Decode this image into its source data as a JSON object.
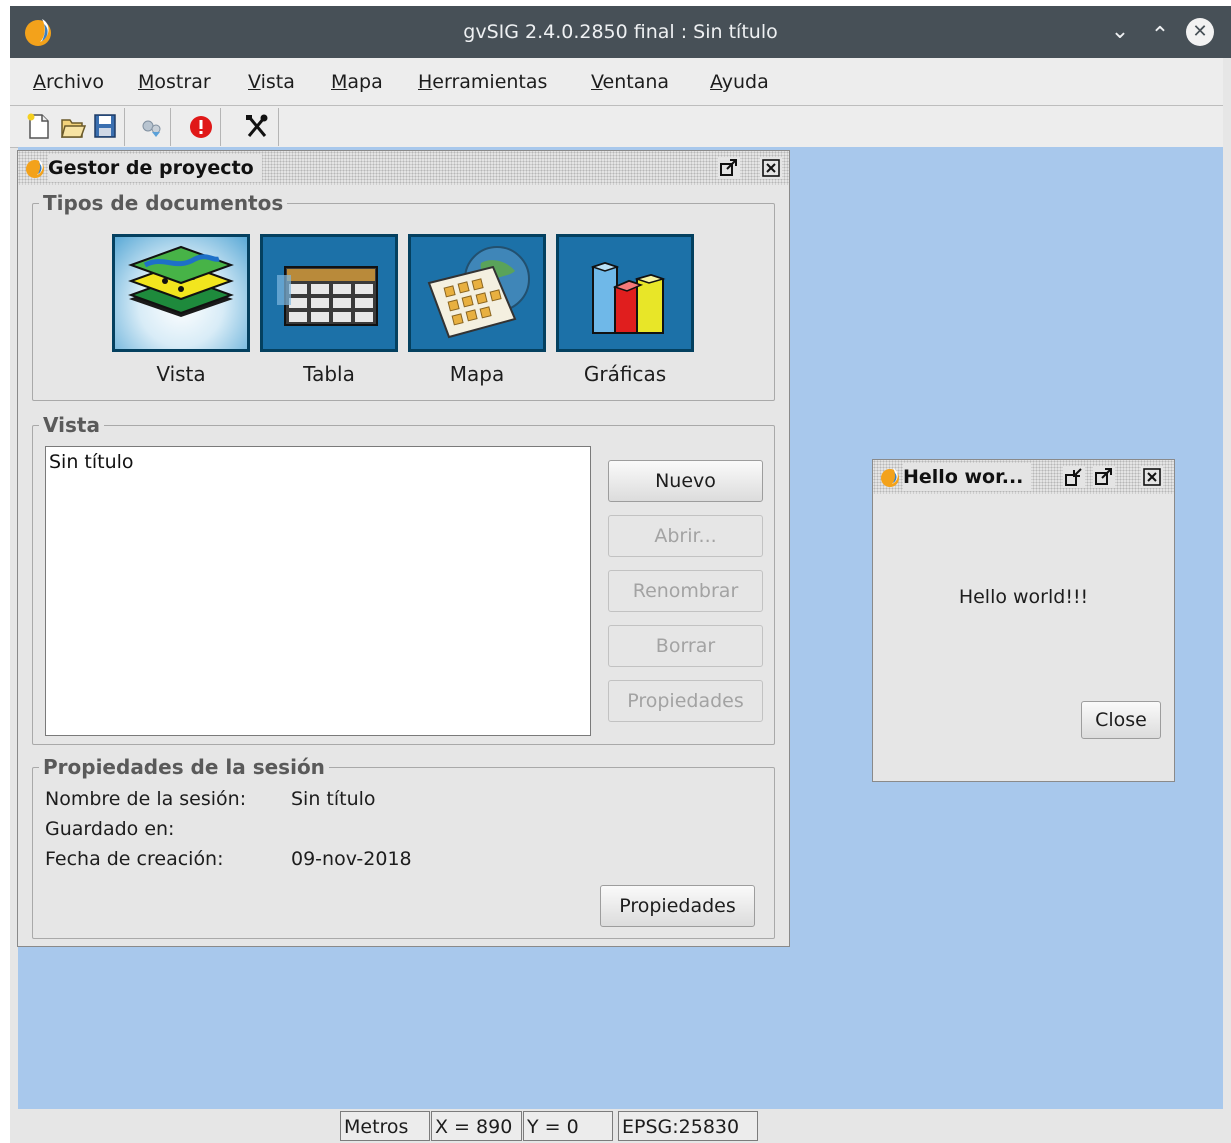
{
  "window": {
    "title": "gvSIG 2.4.0.2850 final : Sin título",
    "controls": [
      "chevron-down-icon",
      "chevron-up-icon",
      "close-icon"
    ]
  },
  "menu": {
    "items": [
      {
        "mnemonic": "A",
        "rest": "rchivo"
      },
      {
        "mnemonic": "M",
        "rest": "ostrar"
      },
      {
        "mnemonic": "V",
        "rest": "ista"
      },
      {
        "mnemonic": "M",
        "rest": "apa"
      },
      {
        "mnemonic": "H",
        "rest": "erramientas"
      },
      {
        "mnemonic": "V",
        "rest": "entana"
      },
      {
        "mnemonic": "A",
        "rest": "yuda"
      }
    ]
  },
  "toolbar": {
    "icons": [
      "new-project-icon",
      "open-project-icon",
      "save-project-icon",
      "preferences-icon",
      "error-icon",
      "tools-icon"
    ]
  },
  "project_manager": {
    "title": "Gestor de proyecto",
    "doc_types_legend": "Tipos de documentos",
    "doc_types": [
      {
        "label": "Vista",
        "icon": "view-layers-icon",
        "selected": true
      },
      {
        "label": "Tabla",
        "icon": "table-icon",
        "selected": false
      },
      {
        "label": "Mapa",
        "icon": "map-layout-icon",
        "selected": false
      },
      {
        "label": "Gráficas",
        "icon": "charts-icon",
        "selected": false
      }
    ],
    "list_legend": "Vista",
    "list_items": [
      "Sin título"
    ],
    "buttons": {
      "new": "Nuevo",
      "open": "Abrir...",
      "rename": "Renombrar",
      "delete": "Borrar",
      "properties": "Propiedades"
    },
    "session_legend": "Propiedades de la sesión",
    "session": {
      "name_label": "Nombre de la sesión:",
      "name_value": "Sin título",
      "saved_label": "Guardado en:",
      "saved_value": "",
      "date_label": "Fecha de creación:",
      "date_value": "09-nov-2018",
      "properties_button": "Propiedades"
    }
  },
  "hello_dialog": {
    "title": "Hello wor...",
    "message": "Hello world!!!",
    "close_button": "Close"
  },
  "statusbar": {
    "units": "Metros",
    "x": "X = 890",
    "y": "Y = 0",
    "crs": "EPSG:25830"
  },
  "colors": {
    "desktop": "#a8c8ec",
    "titlebar": "#475057",
    "icon_frame": "#04405f"
  }
}
